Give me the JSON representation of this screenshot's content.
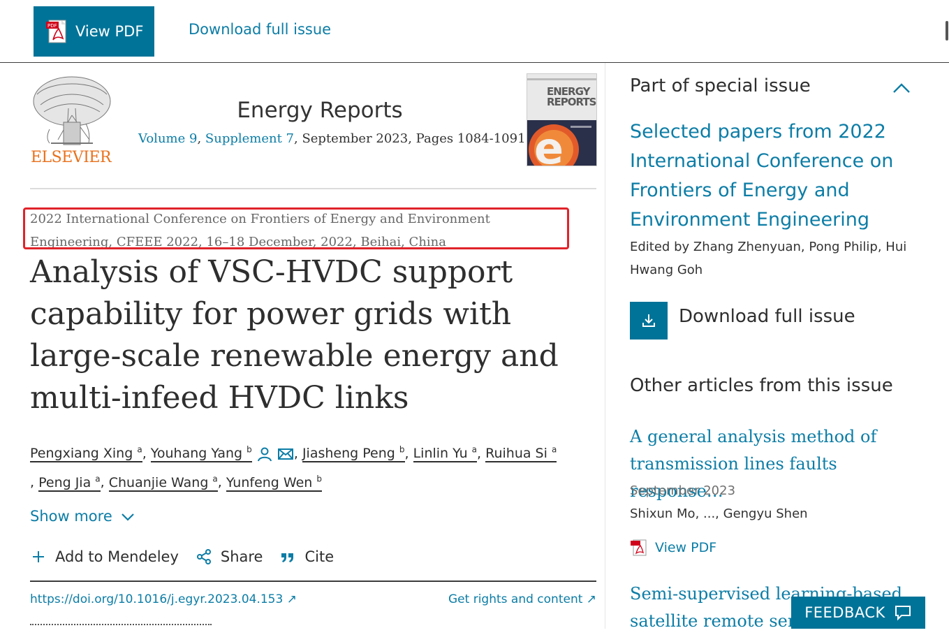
{
  "topbar": {
    "view_pdf_label": "View PDF",
    "download_label": "Download full issue"
  },
  "journal": {
    "publisher_word": "ELSEVIER",
    "title": "Energy Reports",
    "volume_link": "Volume 9",
    "supplement_link": "Supplement 7",
    "sep": ", ",
    "date_pages": ", September 2023, Pages 1084-1091",
    "cover_word1": "ENERGY",
    "cover_word2": "REPORTS",
    "cover_letter": "e"
  },
  "article": {
    "conference": "2022 International Conference on Frontiers of Energy and Environment Engineering, CFEEE 2022, 16–18 December, 2022, Beihai, China",
    "title": "Analysis of VSC-HVDC support capability for power grids with large-scale renewable energy and multi-infeed HVDC links",
    "authors": [
      {
        "name": "Pengxiang Xing",
        "sup": "a"
      },
      {
        "name": "Youhang Yang",
        "sup": "b"
      },
      {
        "name": "Jiasheng Peng",
        "sup": "b"
      },
      {
        "name": "Linlin Yu",
        "sup": "a"
      },
      {
        "name": "Ruihua Si",
        "sup": "a"
      },
      {
        "name": "Peng Jia",
        "sup": "a"
      },
      {
        "name": "Chuanjie Wang",
        "sup": "a"
      },
      {
        "name": "Yunfeng Wen",
        "sup": "b"
      }
    ],
    "separator": ", ",
    "show_more": "Show more",
    "actions": {
      "mendeley": "Add to Mendeley",
      "share": "Share",
      "cite": "Cite"
    },
    "doi": "https://doi.org/10.1016/j.egyr.2023.04.153",
    "rights": "Get rights and content",
    "link_arrow": "↗"
  },
  "sidebar": {
    "special_header": "Part of special issue",
    "special_title": "Selected papers from 2022 International Conference on Frontiers of Energy and Environment Engineering",
    "edited_by": "Edited by Zhang Zhenyuan, Pong Philip, Hui Hwang Goh",
    "download_label": "Download full issue",
    "other_header": "Other articles from this issue",
    "articles": [
      {
        "title": "A general analysis method of transmission lines faults response…",
        "date": "September 2023",
        "authors": "Shixun Mo, ..., Gengyu Shen",
        "pdf_label": "View PDF"
      },
      {
        "title": "Semi-supervised learning-based satellite remote sensi"
      }
    ]
  },
  "feedback_label": "FEEDBACK",
  "colors": {
    "brand": "#007398",
    "link": "#0c7da6",
    "publisher": "#e9711c",
    "highlight": "#e0232a"
  },
  "icons": [
    "pdf-icon",
    "person-icon",
    "envelope-icon",
    "chevron-down-icon",
    "plus-icon",
    "share-icon",
    "quote-icon",
    "chevron-up-icon",
    "download-icon",
    "chat-icon"
  ]
}
